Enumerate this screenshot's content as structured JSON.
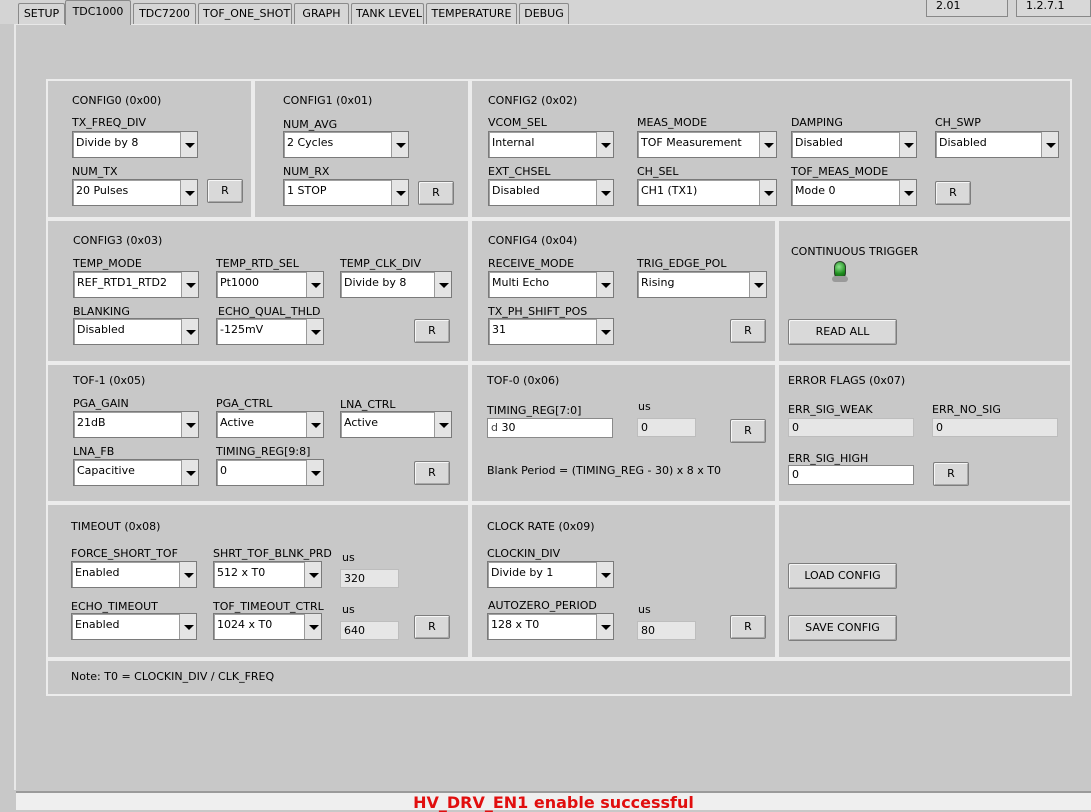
{
  "tabs": [
    "SETUP",
    "TDC1000",
    "TDC7200",
    "TOF_ONE_SHOT",
    "GRAPH",
    "TANK LEVEL",
    "TEMPERATURE",
    "DEBUG"
  ],
  "versions": [
    "2.01",
    "1.2.7.1"
  ],
  "r_label": "R",
  "config0": {
    "title": "CONFIG0 (0x00)",
    "tx_freq_div": {
      "label": "TX_FREQ_DIV",
      "value": "Divide by 8"
    },
    "num_tx": {
      "label": "NUM_TX",
      "value": "20 Pulses"
    }
  },
  "config1": {
    "title": "CONFIG1 (0x01)",
    "num_avg": {
      "label": "NUM_AVG",
      "value": "2 Cycles"
    },
    "num_rx": {
      "label": "NUM_RX",
      "value": "1 STOP"
    }
  },
  "config2": {
    "title": "CONFIG2 (0x02)",
    "vcom_sel": {
      "label": "VCOM_SEL",
      "value": "Internal"
    },
    "meas_mode": {
      "label": "MEAS_MODE",
      "value": "TOF Measurement"
    },
    "damping": {
      "label": "DAMPING",
      "value": "Disabled"
    },
    "ch_swp": {
      "label": "CH_SWP",
      "value": "Disabled"
    },
    "ext_chsel": {
      "label": "EXT_CHSEL",
      "value": "Disabled"
    },
    "ch_sel": {
      "label": "CH_SEL",
      "value": "CH1 (TX1)"
    },
    "tof_meas_mode": {
      "label": "TOF_MEAS_MODE",
      "value": "Mode 0"
    }
  },
  "config3": {
    "title": "CONFIG3 (0x03)",
    "temp_mode": {
      "label": "TEMP_MODE",
      "value": "REF_RTD1_RTD2"
    },
    "temp_rtd_sel": {
      "label": "TEMP_RTD_SEL",
      "value": "Pt1000"
    },
    "temp_clk_div": {
      "label": "TEMP_CLK_DIV",
      "value": "Divide by 8"
    },
    "blanking": {
      "label": "BLANKING",
      "value": "Disabled"
    },
    "echo_qual_thld": {
      "label": "ECHO_QUAL_THLD",
      "value": "-125mV"
    }
  },
  "config4": {
    "title": "CONFIG4 (0x04)",
    "receive_mode": {
      "label": "RECEIVE_MODE",
      "value": "Multi Echo"
    },
    "trig_edge_pol": {
      "label": "TRIG_EDGE_POL",
      "value": "Rising"
    },
    "tx_ph_shift_pos": {
      "label": "TX_PH_SHIFT_POS",
      "value": "31"
    }
  },
  "trigger": {
    "label": "CONTINUOUS TRIGGER",
    "read_all": "READ ALL"
  },
  "tof1": {
    "title": "TOF-1 (0x05)",
    "pga_gain": {
      "label": "PGA_GAIN",
      "value": "21dB"
    },
    "pga_ctrl": {
      "label": "PGA_CTRL",
      "value": "Active"
    },
    "lna_ctrl": {
      "label": "LNA_CTRL",
      "value": "Active"
    },
    "lna_fb": {
      "label": "LNA_FB",
      "value": "Capacitive"
    },
    "timing_reg_hi": {
      "label": "TIMING_REG[9:8]",
      "value": "0"
    }
  },
  "tof0": {
    "title": "TOF-0 (0x06)",
    "timing_reg_lo": {
      "label": "TIMING_REG[7:0]",
      "prefix": "d",
      "value": "30"
    },
    "us_label": "us",
    "us_value": "0",
    "note": "Blank Period = (TIMING_REG - 30) x 8 x T0"
  },
  "errors": {
    "title": "ERROR FLAGS (0x07)",
    "err_sig_weak": {
      "label": "ERR_SIG_WEAK",
      "value": "0"
    },
    "err_no_sig": {
      "label": "ERR_NO_SIG",
      "value": "0"
    },
    "err_sig_high": {
      "label": "ERR_SIG_HIGH",
      "value": "0"
    }
  },
  "timeout": {
    "title": "TIMEOUT (0x08)",
    "force_short_tof": {
      "label": "FORCE_SHORT_TOF",
      "value": "Enabled"
    },
    "shrt_tof_blnk_prd": {
      "label": "SHRT_TOF_BLNK_PRD",
      "value": "512 x T0"
    },
    "us1": {
      "label": "us",
      "value": "320"
    },
    "echo_timeout": {
      "label": "ECHO_TIMEOUT",
      "value": "Enabled"
    },
    "tof_timeout_ctrl": {
      "label": "TOF_TIMEOUT_CTRL",
      "value": "1024 x T0"
    },
    "us2": {
      "label": "us",
      "value": "640"
    }
  },
  "clock": {
    "title": "CLOCK RATE (0x09)",
    "clockin_div": {
      "label": "CLOCKIN_DIV",
      "value": "Divide by 1"
    },
    "autozero_period": {
      "label": "AUTOZERO_PERIOD",
      "value": "128 x T0"
    },
    "us": {
      "label": "us",
      "value": "80"
    }
  },
  "config_buttons": {
    "load": "LOAD CONFIG",
    "save": "SAVE CONFIG"
  },
  "note": "Note: T0 = CLOCKIN_DIV / CLK_FREQ",
  "status": "HV_DRV_EN1 enable successful",
  "colors": {
    "status_text": "#e10e0e",
    "panel": "#c8c8c8",
    "led": "#1e8e1e"
  }
}
